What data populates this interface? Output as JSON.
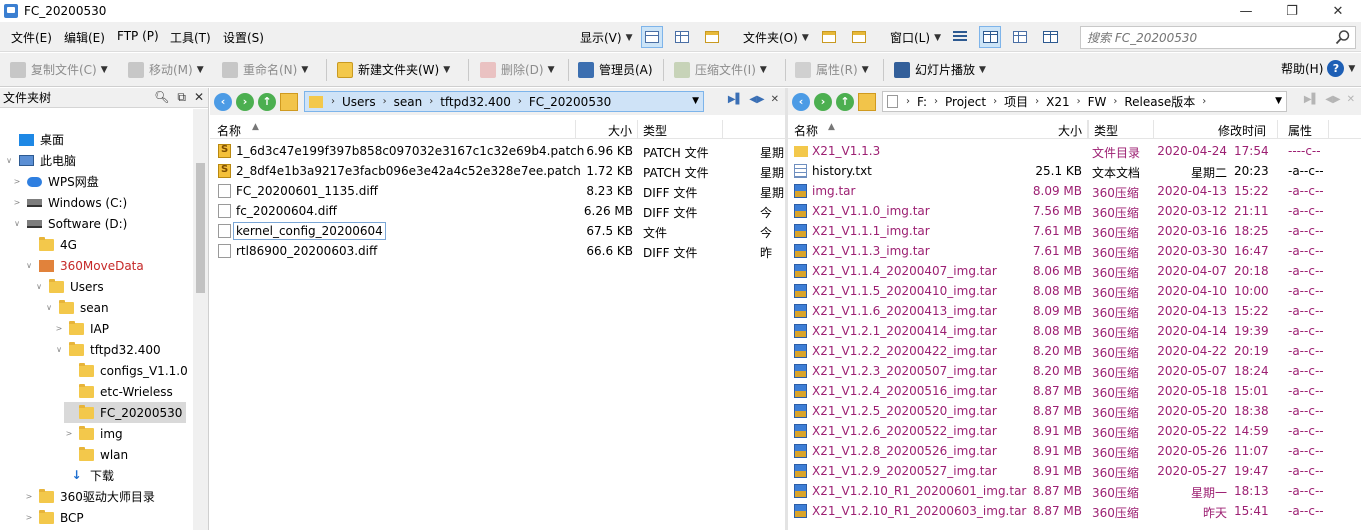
{
  "window": {
    "title": "FC_20200530",
    "min": "—",
    "restore": "❐",
    "close": "✕"
  },
  "menu": {
    "items": [
      "文件(E)",
      "编辑(E)",
      "FTP (P)",
      "工具(T)",
      "设置(S)"
    ],
    "view_label": "显示(V)",
    "folder_label": "文件夹(O)",
    "window_label": "窗口(L)",
    "search_placeholder": "搜索 FC_20200530"
  },
  "toolbar": {
    "copy": "复制文件(C)",
    "move": "移动(M)",
    "rename": "重命名(N)",
    "new_folder": "新建文件夹(W)",
    "delete": "删除(D)",
    "admin": "管理员(A)",
    "compress": "压缩文件(I)",
    "properties": "属性(R)",
    "slideshow": "幻灯片播放",
    "help": "帮助(H)",
    "help_glyph": "?"
  },
  "tree": {
    "title": "文件夹树",
    "items": [
      {
        "label": "桌面",
        "level": 0,
        "type": "desktop",
        "twisty": ""
      },
      {
        "label": "此电脑",
        "level": 0,
        "type": "pc",
        "twisty": "∨"
      },
      {
        "label": "WPS网盘",
        "level": 1,
        "type": "cloud",
        "twisty": ">"
      },
      {
        "label": "Windows (C:)",
        "level": 1,
        "type": "drive",
        "twisty": ">"
      },
      {
        "label": "Software (D:)",
        "level": 1,
        "type": "drive",
        "twisty": "∨"
      },
      {
        "label": "4G",
        "level": 2,
        "type": "folder",
        "twisty": ""
      },
      {
        "label": "360MoveData",
        "level": 2,
        "type": "special",
        "twisty": "∨"
      },
      {
        "label": "Users",
        "level": 3,
        "type": "folder",
        "twisty": "∨"
      },
      {
        "label": "sean",
        "level": 4,
        "type": "folder",
        "twisty": "∨"
      },
      {
        "label": "IAP",
        "level": 5,
        "type": "folder",
        "twisty": ">"
      },
      {
        "label": "tftpd32.400",
        "level": 5,
        "type": "folder",
        "twisty": "∨"
      },
      {
        "label": "configs_V1.1.0",
        "level": 6,
        "type": "folder",
        "twisty": ""
      },
      {
        "label": "etc-Wrieless",
        "level": 6,
        "type": "folder",
        "twisty": ""
      },
      {
        "label": "FC_20200530",
        "level": 6,
        "type": "folder",
        "twisty": "",
        "selected": true
      },
      {
        "label": "img",
        "level": 6,
        "type": "folder",
        "twisty": ">"
      },
      {
        "label": "wlan",
        "level": 6,
        "type": "folder",
        "twisty": ""
      },
      {
        "label": "下载",
        "level": 5,
        "type": "download",
        "twisty": ""
      },
      {
        "label": "360驱动大师目录",
        "level": 2,
        "type": "folder",
        "twisty": ">"
      },
      {
        "label": "BCP",
        "level": 2,
        "type": "folder",
        "twisty": ">"
      }
    ]
  },
  "left_pane": {
    "path": [
      "Users",
      "sean",
      "tftpd32.400",
      "FC_20200530"
    ],
    "columns": {
      "name": "名称",
      "size": "大小",
      "type": "类型"
    },
    "files": [
      {
        "name": "1_6d3c47e199f397b858c097032e3167c1c32e69b4.patch",
        "size": "6.96 KB",
        "type": "PATCH 文件",
        "extra": "星期",
        "icon": "patch"
      },
      {
        "name": "2_8df4e1b3a9217e3facb096e3e42a4c52e328e7ee.patch",
        "size": "1.72 KB",
        "type": "PATCH 文件",
        "extra": "星期",
        "icon": "patch"
      },
      {
        "name": "FC_20200601_1135.diff",
        "size": "8.23 KB",
        "type": "DIFF 文件",
        "extra": "星期",
        "icon": "doc"
      },
      {
        "name": "fc_20200604.diff",
        "size": "6.26 MB",
        "type": "DIFF 文件",
        "extra": "今",
        "icon": "doc"
      },
      {
        "name": "kernel_config_20200604",
        "size": "67.5 KB",
        "type": "文件",
        "extra": "今",
        "icon": "doc",
        "editing": true
      },
      {
        "name": "rtl86900_20200603.diff",
        "size": "66.6 KB",
        "type": "DIFF 文件",
        "extra": "昨",
        "icon": "doc"
      }
    ]
  },
  "right_pane": {
    "path": [
      "F:",
      "Project",
      "项目",
      "X21",
      "FW",
      "Release版本"
    ],
    "columns": {
      "name": "名称",
      "size": "大小",
      "type": "类型",
      "modified": "修改时间",
      "attr": "属性"
    },
    "files": [
      {
        "name": "X21_V1.1.3",
        "size": "",
        "type": "文件目录",
        "date": "2020-04-24",
        "time": "17:54",
        "attr": "----c--",
        "icon": "folder"
      },
      {
        "name": "history.txt",
        "size": "25.1 KB",
        "type": "文本文档",
        "date": "星期二",
        "time": "20:23",
        "attr": "-a--c--",
        "icon": "txt"
      },
      {
        "name": "img.tar",
        "size": "8.09 MB",
        "type": "360压缩",
        "date": "2020-04-13",
        "time": "15:22",
        "attr": "-a--c--",
        "icon": "tar"
      },
      {
        "name": "X21_V1.1.0_img.tar",
        "size": "7.56 MB",
        "type": "360压缩",
        "date": "2020-03-12",
        "time": "21:11",
        "attr": "-a--c--",
        "icon": "tar"
      },
      {
        "name": "X21_V1.1.1_img.tar",
        "size": "7.61 MB",
        "type": "360压缩",
        "date": "2020-03-16",
        "time": "18:25",
        "attr": "-a--c--",
        "icon": "tar"
      },
      {
        "name": "X21_V1.1.3_img.tar",
        "size": "7.61 MB",
        "type": "360压缩",
        "date": "2020-03-30",
        "time": "16:47",
        "attr": "-a--c--",
        "icon": "tar"
      },
      {
        "name": "X21_V1.1.4_20200407_img.tar",
        "size": "8.06 MB",
        "type": "360压缩",
        "date": "2020-04-07",
        "time": "20:18",
        "attr": "-a--c--",
        "icon": "tar"
      },
      {
        "name": "X21_V1.1.5_20200410_img.tar",
        "size": "8.08 MB",
        "type": "360压缩",
        "date": "2020-04-10",
        "time": "10:00",
        "attr": "-a--c--",
        "icon": "tar"
      },
      {
        "name": "X21_V1.1.6_20200413_img.tar",
        "size": "8.09 MB",
        "type": "360压缩",
        "date": "2020-04-13",
        "time": "15:22",
        "attr": "-a--c--",
        "icon": "tar"
      },
      {
        "name": "X21_V1.2.1_20200414_img.tar",
        "size": "8.08 MB",
        "type": "360压缩",
        "date": "2020-04-14",
        "time": "19:39",
        "attr": "-a--c--",
        "icon": "tar"
      },
      {
        "name": "X21_V1.2.2_20200422_img.tar",
        "size": "8.20 MB",
        "type": "360压缩",
        "date": "2020-04-22",
        "time": "20:19",
        "attr": "-a--c--",
        "icon": "tar"
      },
      {
        "name": "X21_V1.2.3_20200507_img.tar",
        "size": "8.20 MB",
        "type": "360压缩",
        "date": "2020-05-07",
        "time": "18:24",
        "attr": "-a--c--",
        "icon": "tar"
      },
      {
        "name": "X21_V1.2.4_20200516_img.tar",
        "size": "8.87 MB",
        "type": "360压缩",
        "date": "2020-05-18",
        "time": "15:01",
        "attr": "-a--c--",
        "icon": "tar"
      },
      {
        "name": "X21_V1.2.5_20200520_img.tar",
        "size": "8.87 MB",
        "type": "360压缩",
        "date": "2020-05-20",
        "time": "18:38",
        "attr": "-a--c--",
        "icon": "tar"
      },
      {
        "name": "X21_V1.2.6_20200522_img.tar",
        "size": "8.91 MB",
        "type": "360压缩",
        "date": "2020-05-22",
        "time": "14:59",
        "attr": "-a--c--",
        "icon": "tar"
      },
      {
        "name": "X21_V1.2.8_20200526_img.tar",
        "size": "8.91 MB",
        "type": "360压缩",
        "date": "2020-05-26",
        "time": "11:07",
        "attr": "-a--c--",
        "icon": "tar"
      },
      {
        "name": "X21_V1.2.9_20200527_img.tar",
        "size": "8.91 MB",
        "type": "360压缩",
        "date": "2020-05-27",
        "time": "19:47",
        "attr": "-a--c--",
        "icon": "tar"
      },
      {
        "name": "X21_V1.2.10_R1_20200601_img.tar",
        "size": "8.87 MB",
        "type": "360压缩",
        "date": "星期一",
        "time": "18:13",
        "attr": "-a--c--",
        "icon": "tar"
      },
      {
        "name": "X21_V1.2.10_R1_20200603_img.tar",
        "size": "8.87 MB",
        "type": "360压缩",
        "date": "昨天",
        "time": "15:41",
        "attr": "-a--c--",
        "icon": "tar"
      }
    ]
  },
  "colors": {
    "accent": "#cce4f7",
    "compressed_text": "#9c1f72",
    "selection": "#d9d9d9"
  }
}
